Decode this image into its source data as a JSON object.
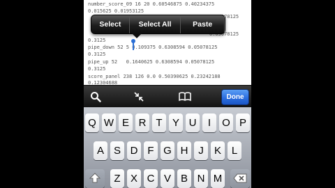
{
  "document": {
    "lines": [
      "number_score_09 16 20 0.60546875 0.40234375",
      "0.015625 0.01953125",
      "",
      "",
      "0.3125",
      "pipe_down 52 5 0.109375 0.6308594 0.05078125",
      "0.3125",
      "pipe_up 52   0.1640625 0.6308594 0.05078125",
      "0.3125",
      "",
      "score_panel 238 126 0.0 0.50390625 0.23242188",
      "0.12304688"
    ],
    "hidden_fragments": {
      "line3_right": "0.05078125",
      "line4_right": "0.05078125"
    }
  },
  "edit_menu": {
    "select_label": "Select",
    "select_all_label": "Select All",
    "paste_label": "Paste"
  },
  "accessory_bar": {
    "done_label": "Done",
    "icons": [
      "search-icon",
      "collapse-icon",
      "book-icon"
    ]
  },
  "keyboard": {
    "row1": [
      "Q",
      "W",
      "E",
      "R",
      "T",
      "Y",
      "U",
      "I",
      "O",
      "P"
    ],
    "row2": [
      "A",
      "S",
      "D",
      "F",
      "G",
      "H",
      "J",
      "K",
      "L"
    ],
    "row3": [
      "Z",
      "X",
      "C",
      "V",
      "B",
      "N",
      "M"
    ],
    "special_keys": [
      "shift-icon",
      "delete-icon"
    ]
  },
  "colors": {
    "accent": "#2d6fe0",
    "cursor": "#2a6fd6",
    "menu_dark": "#1e1e1e"
  }
}
